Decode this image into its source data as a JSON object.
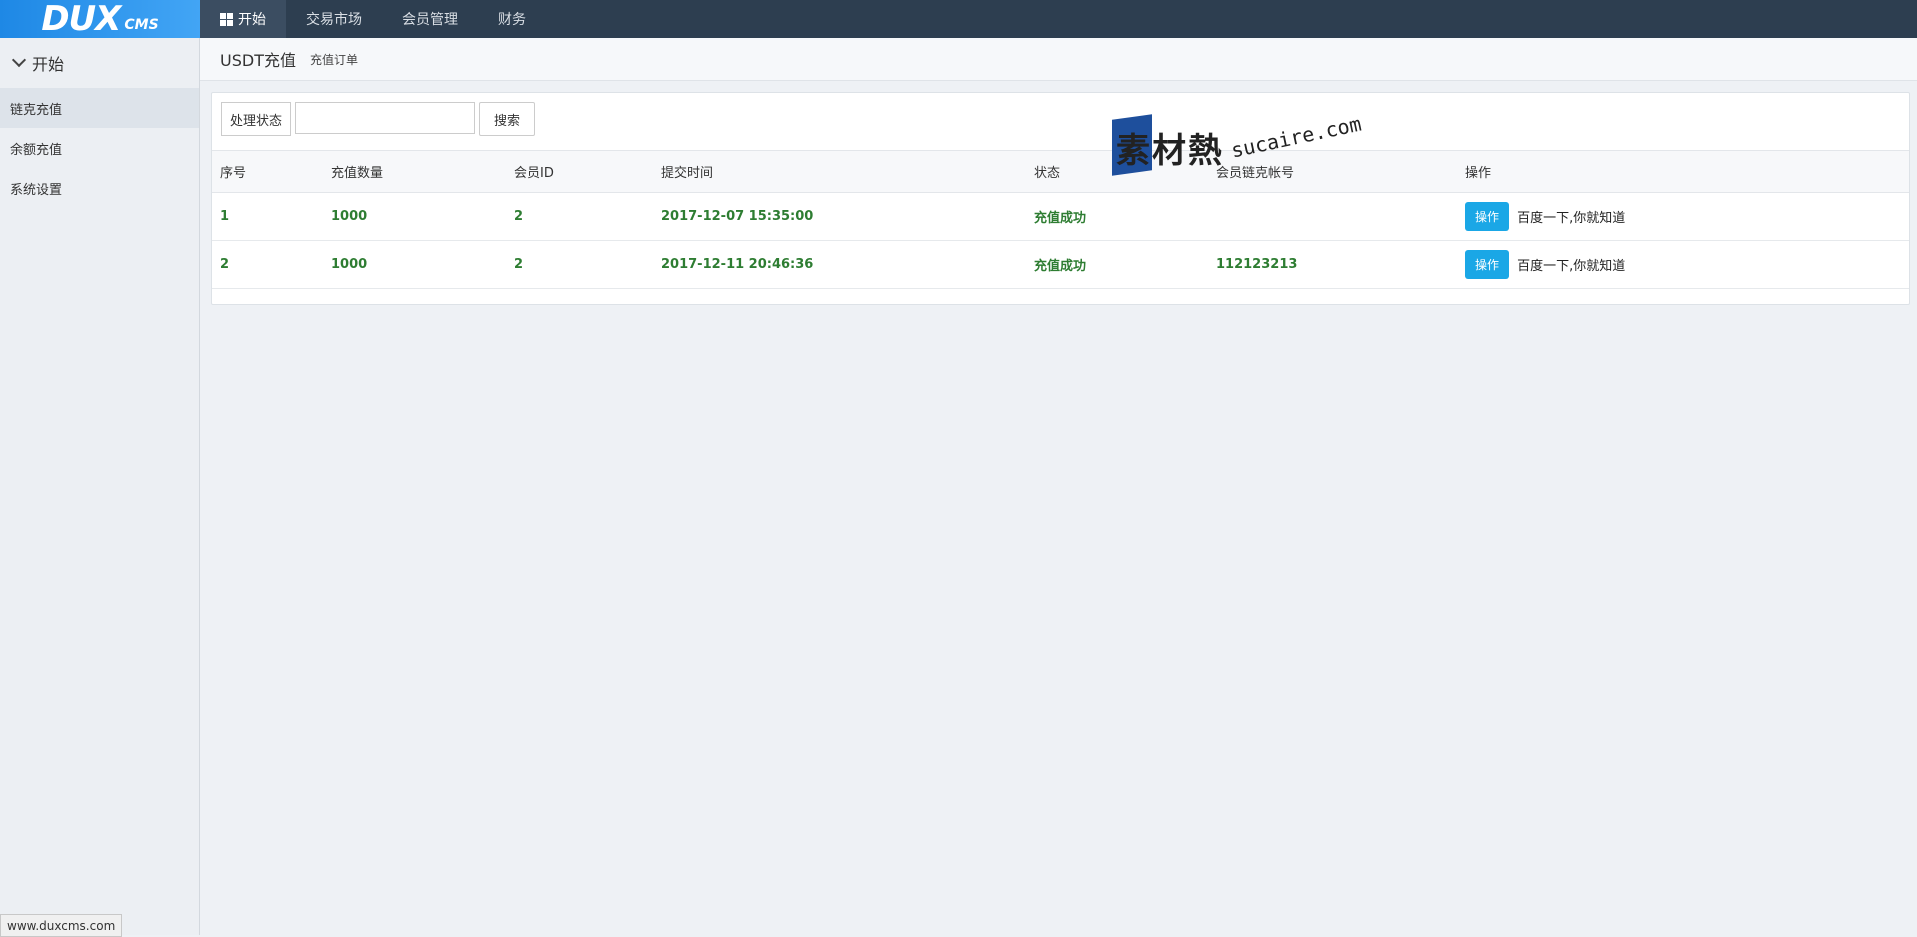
{
  "brand": {
    "logo_main": "DUX",
    "logo_sub": "CMS"
  },
  "topnav": {
    "items": [
      {
        "label": "开始",
        "active": true
      },
      {
        "label": "交易市场"
      },
      {
        "label": "会员管理"
      },
      {
        "label": "财务"
      }
    ]
  },
  "sidebar": {
    "title": "开始",
    "items": [
      {
        "label": "链克充值",
        "active": true
      },
      {
        "label": "余额充值"
      },
      {
        "label": "系统设置"
      }
    ]
  },
  "header": {
    "title": "USDT充值",
    "subtitle": "充值订单"
  },
  "search": {
    "addon_label": "处理状态",
    "input_value": "",
    "button_label": "搜索"
  },
  "table": {
    "columns": [
      "序号",
      "充值数量",
      "会员ID",
      "提交时间",
      "状态",
      "会员链克帐号",
      "操作"
    ],
    "rows": [
      {
        "id": "1",
        "amount": "1000",
        "member_id": "2",
        "time": "2017-12-07 15:35:00",
        "status": "充值成功",
        "account": "",
        "op_button": "操作",
        "op_text": "百度一下,你就知道"
      },
      {
        "id": "2",
        "amount": "1000",
        "member_id": "2",
        "time": "2017-12-11 20:46:36",
        "status": "充值成功",
        "account": "112123213",
        "op_button": "操作",
        "op_text": "百度一下,你就知道"
      }
    ]
  },
  "watermark": {
    "cn": "素材熱",
    "latin": "sucaire.com"
  },
  "statusbar": {
    "url": "www.duxcms.com"
  },
  "colors": {
    "accent": "#1aa7e6",
    "success_text": "#2e7d32",
    "topbar": "#2d3e50"
  }
}
